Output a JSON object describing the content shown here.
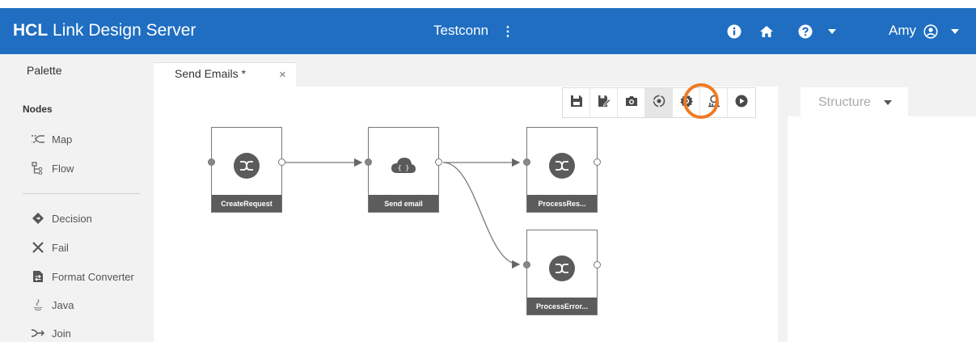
{
  "header": {
    "app_brand": "HCL",
    "app_name": "Link Design Server",
    "project": "Testconn",
    "kebab": "⋮",
    "user": "Amy",
    "bg_color": "#1f6ec1"
  },
  "palette": {
    "title": "Palette",
    "section": "Nodes",
    "items": [
      {
        "label": "Map",
        "icon": "map-icon"
      },
      {
        "label": "Flow",
        "icon": "flow-icon"
      },
      {
        "label": "Decision",
        "icon": "decision-icon"
      },
      {
        "label": "Fail",
        "icon": "fail-icon"
      },
      {
        "label": "Format Converter",
        "icon": "format-converter-icon"
      },
      {
        "label": "Java",
        "icon": "java-icon"
      },
      {
        "label": "Join",
        "icon": "join-icon"
      }
    ]
  },
  "tab": {
    "label": "Send Emails *",
    "close": "×"
  },
  "toolbar": {
    "buttons": [
      "save-icon",
      "save-as-icon",
      "camera-icon",
      "view-icon",
      "settings-icon",
      "monitor-icon",
      "run-icon"
    ],
    "highlight_color": "#ef7a22"
  },
  "structure": {
    "label": "Structure"
  },
  "nodes": [
    {
      "label": "CreateRequest",
      "icon": "map-node-icon"
    },
    {
      "label": "Send email",
      "icon": "cloud-node-icon"
    },
    {
      "label": "ProcessRes...",
      "icon": "map-node-icon"
    },
    {
      "label": "ProcessError...",
      "icon": "map-node-icon"
    }
  ]
}
